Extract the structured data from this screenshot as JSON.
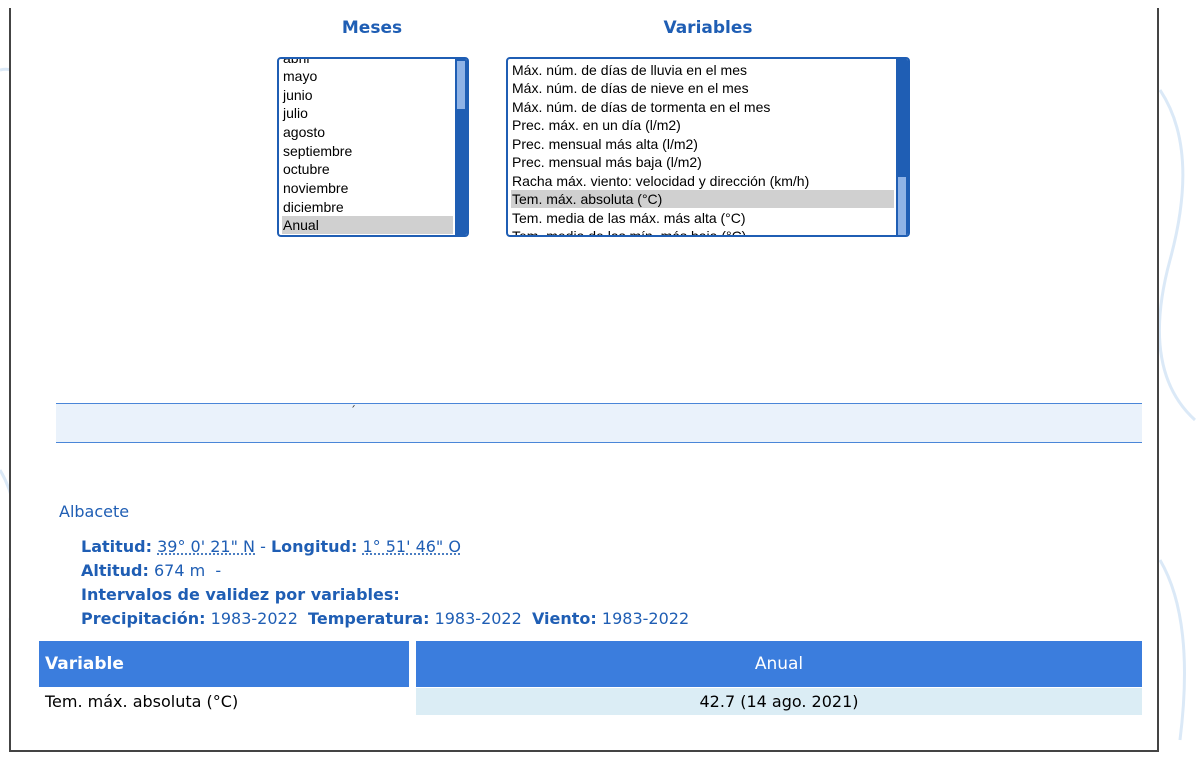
{
  "filters": {
    "months_title": "Meses",
    "variables_title": "Variables",
    "months": [
      {
        "label": "abril",
        "selected": false
      },
      {
        "label": "mayo",
        "selected": false
      },
      {
        "label": "junio",
        "selected": false
      },
      {
        "label": "julio",
        "selected": false
      },
      {
        "label": "agosto",
        "selected": false
      },
      {
        "label": "septiembre",
        "selected": false
      },
      {
        "label": "octubre",
        "selected": false
      },
      {
        "label": "noviembre",
        "selected": false
      },
      {
        "label": "diciembre",
        "selected": false
      },
      {
        "label": "Anual",
        "selected": true
      }
    ],
    "variables": [
      {
        "label": "Máx. núm. de días de lluvia en el mes",
        "selected": false
      },
      {
        "label": "Máx. núm. de días de nieve en el mes",
        "selected": false
      },
      {
        "label": "Máx. núm. de días de tormenta en el mes",
        "selected": false
      },
      {
        "label": "Prec. máx. en un día (l/m2)",
        "selected": false
      },
      {
        "label": "Prec. mensual más alta (l/m2)",
        "selected": false
      },
      {
        "label": "Prec. mensual más baja (l/m2)",
        "selected": false
      },
      {
        "label": "Racha máx. viento: velocidad y dirección (km/h)",
        "selected": false
      },
      {
        "label": "Tem. máx. absoluta (°C)",
        "selected": true
      },
      {
        "label": "Tem. media de las máx. más alta (°C)",
        "selected": false
      },
      {
        "label": "Tem. media de las mín. más baja (°C)",
        "selected": false
      }
    ]
  },
  "band_mark": "´",
  "station": {
    "name": "Albacete",
    "lat_label": "Latitud:",
    "lat_value": "39° 0' 21\" N",
    "separator": " - ",
    "lon_label": "Longitud:",
    "lon_value": "1° 51' 46\" O",
    "alt_label": "Altitud:",
    "alt_value": " 674 m  -",
    "intervals_label": "Intervalos de validez por variables:",
    "precip_label": "Precipitación:",
    "precip_value": " 1983-2022",
    "temp_label": "Temperatura:",
    "temp_value": " 1983-2022",
    "wind_label": "Viento:",
    "wind_value": " 1983-2022"
  },
  "table": {
    "col_variable": "Variable",
    "col_annual": "Anual",
    "row_variable": "Tem. máx. absoluta (°C)",
    "row_value": "42.7 (14 ago. 2021)"
  },
  "colors": {
    "accent": "#1f5eb4",
    "header_bg": "#3b7ddd",
    "cell_bg": "#dbedf5"
  }
}
